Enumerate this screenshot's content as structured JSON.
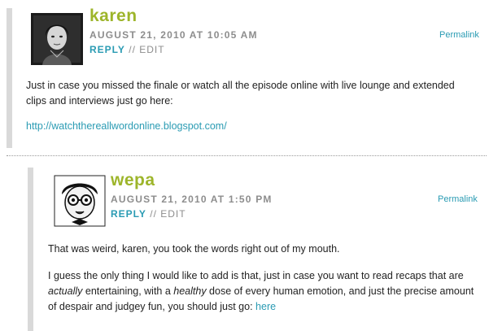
{
  "colors": {
    "author": "#9db52a",
    "link": "#2a9bb3",
    "meta": "#8d8d8d",
    "body_text": "#222222",
    "indent_bar": "#d9d9d9"
  },
  "comments": [
    {
      "author": "karen",
      "date": "August 21, 2010 at 10:05 am",
      "reply_label": "REPLY",
      "separator": "//",
      "edit_label": "EDIT",
      "permalink_label": "Permalink",
      "avatar_icon": "woman-portrait-photo",
      "body": {
        "p1": "Just in case you missed the finale or watch all the episode online with live lounge and extended clips and interviews just go here:",
        "link": "http://watchthereallwordonline.blogspot.com/"
      }
    },
    {
      "author": "wepa",
      "date": "August 21, 2010 at 1:50 pm",
      "reply_label": "REPLY",
      "separator": "//",
      "edit_label": "EDIT",
      "permalink_label": "Permalink",
      "avatar_icon": "illustrated-character-avatar",
      "body": {
        "p1": "That was weird, karen, you took the words right out of my mouth.",
        "p2_a": "I guess the only thing I would like to add is that, just in case you want to read recaps that are ",
        "p2_em1": "actually",
        "p2_b": " entertaining, with a ",
        "p2_em2": "healthy",
        "p2_c": " dose of every human emotion, and just the precise amount of despair and judgey fun, you should just go: ",
        "p2_link": "here"
      }
    }
  ]
}
